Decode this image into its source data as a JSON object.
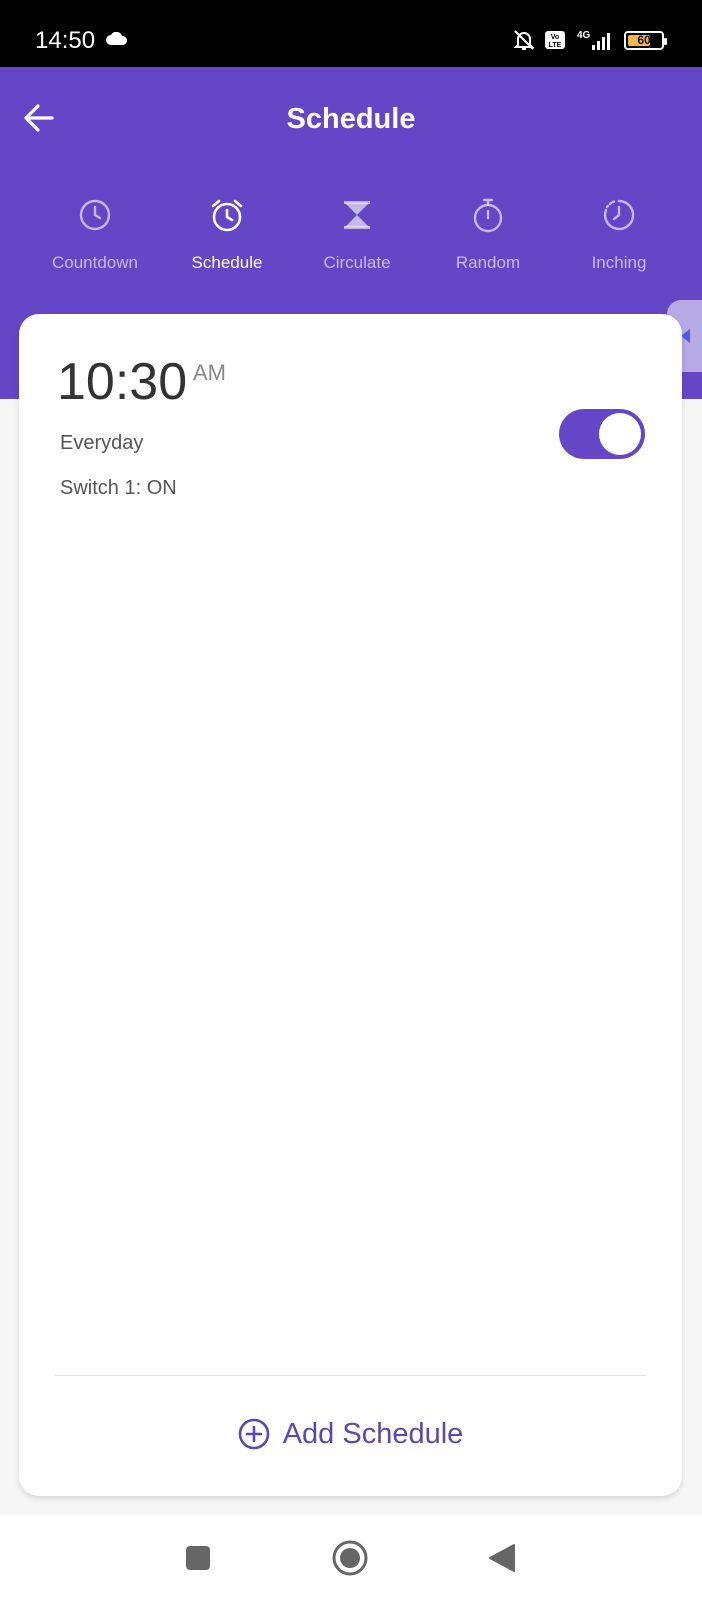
{
  "status_bar": {
    "time": "14:50",
    "battery_level": "60",
    "network": "4G",
    "volte": "Vo LTE"
  },
  "header": {
    "title": "Schedule",
    "accent_color": "#6447c6"
  },
  "tabs": [
    {
      "label": "Countdown",
      "icon": "clock-icon",
      "active": false
    },
    {
      "label": "Schedule",
      "icon": "alarm-clock-icon",
      "active": true
    },
    {
      "label": "Circulate",
      "icon": "hourglass-icon",
      "active": false
    },
    {
      "label": "Random",
      "icon": "stopwatch-icon",
      "active": false
    },
    {
      "label": "Inching",
      "icon": "timer-dashed-icon",
      "active": false
    }
  ],
  "schedules": [
    {
      "time": "10:30",
      "ampm": "AM",
      "repeat": "Everyday",
      "action": "Switch 1: ON",
      "enabled": true
    }
  ],
  "footer": {
    "add_label": "Add Schedule"
  }
}
